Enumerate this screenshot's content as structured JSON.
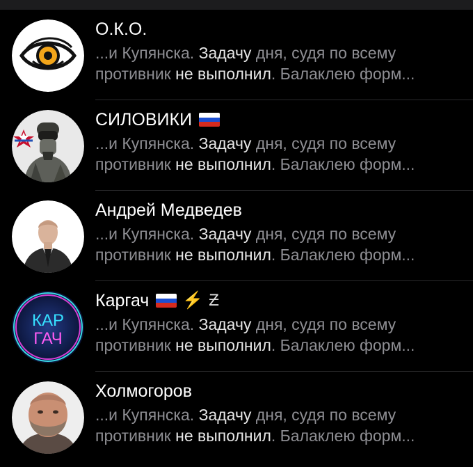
{
  "chats": [
    {
      "name": "О.К.О.",
      "avatar_icon": "eye-logo",
      "preview": {
        "p1": "...и Купянска. ",
        "h1": "Задачу",
        "p2": " дня, судя по всему",
        "p3": "противник ",
        "h2": "не выполнил",
        "p4": ". Балаклею форм..."
      }
    },
    {
      "name": "СИЛОВИКИ",
      "flag_icon": "russia-flag",
      "avatar_icon": "soldier-photo",
      "preview": {
        "p1": "...и Купянска. ",
        "h1": "Задачу",
        "p2": " дня, судя по всему",
        "p3": "противник ",
        "h2": "не выполнил",
        "p4": ". Балаклею форм..."
      }
    },
    {
      "name": "Андрей Медведев",
      "avatar_icon": "person-photo",
      "preview": {
        "p1": "...и Купянска. ",
        "h1": "Задачу",
        "p2": " дня, судя по всему",
        "p3": "противник ",
        "h2": "не выполнил",
        "p4": ". Балаклею форм..."
      }
    },
    {
      "name": "Каргач",
      "flag_icon": "russia-flag",
      "bolt_glyph": "⚡",
      "z_glyph": "Ƶ",
      "avatar_text_top": "КАР",
      "avatar_text_bottom": "ГАЧ",
      "preview": {
        "p1": "...и Купянска. ",
        "h1": "Задачу",
        "p2": " дня, судя по всему",
        "p3": "противник ",
        "h2": "не выполнил",
        "p4": ". Балаклею форм..."
      }
    },
    {
      "name": "Холмогоров",
      "avatar_icon": "bearded-man-photo",
      "preview": {
        "p1": "...и Купянска. ",
        "h1": "Задачу",
        "p2": " дня, судя по всему",
        "p3": "противник ",
        "h2": "не выполнил",
        "p4": ". Балаклею форм..."
      }
    }
  ],
  "colors": {
    "background": "#000000",
    "title": "#ffffff",
    "preview_muted": "#8e8e93",
    "preview_highlight": "#e6e6e6",
    "divider": "#2c2c2e"
  }
}
